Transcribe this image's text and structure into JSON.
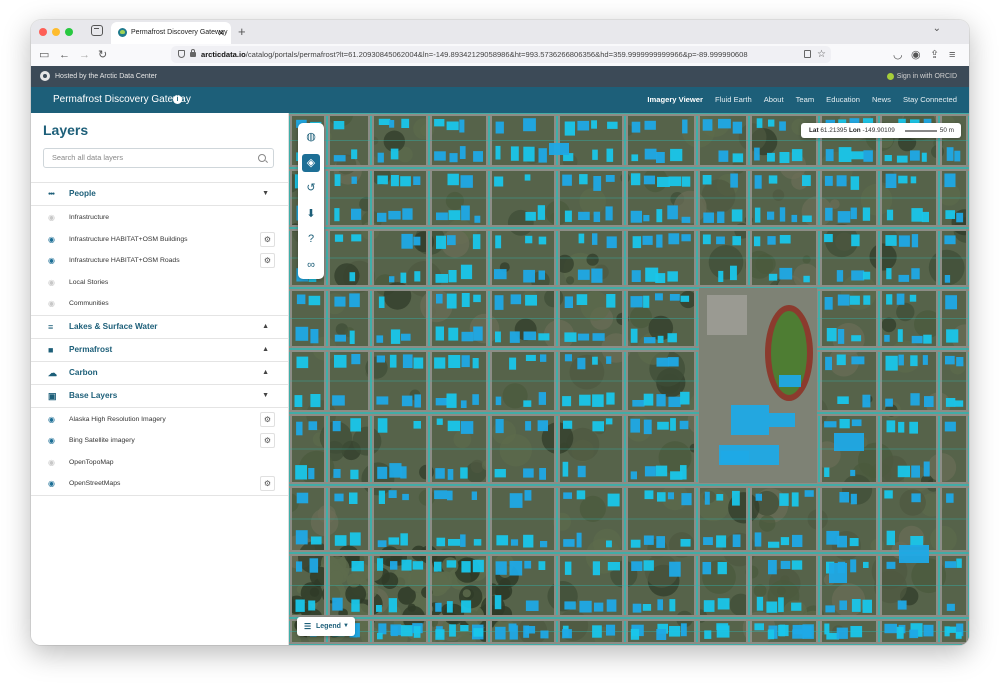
{
  "browser": {
    "tab_title": "Permafrost Discovery Gateway",
    "tab_close": "✕",
    "new_tab": "+",
    "url_host": "arcticdata.io",
    "url_rest": "/catalog/portals/permafrost?lt=61.20930845062004&ln=-149.89342129058986&ht=993.5736266806356&hd=359.9999999999966&p=-89.999990608"
  },
  "site": {
    "hosted_by": "Hosted by the Arctic Data Center",
    "sign_in": "Sign in with ORCID",
    "brand": "Permafrost Discovery Gateway",
    "nav": [
      "Imagery Viewer",
      "Fluid Earth",
      "About",
      "Team",
      "Education",
      "News",
      "Stay Connected"
    ]
  },
  "panel": {
    "title": "Layers",
    "search_placeholder": "Search all data layers",
    "groups": [
      {
        "label": "People",
        "icon": "people-icon",
        "expanded": true,
        "items": [
          {
            "label": "Infrastructure",
            "visible": false,
            "settings": false
          },
          {
            "label": "Infrastructure HABITAT+OSM Buildings",
            "visible": true,
            "settings": true
          },
          {
            "label": "Infrastructure HABITAT+OSM Roads",
            "visible": true,
            "settings": true
          },
          {
            "label": "Local Stories",
            "visible": false,
            "settings": false
          },
          {
            "label": "Communities",
            "visible": false,
            "settings": false
          }
        ]
      },
      {
        "label": "Lakes & Surface Water",
        "icon": "water-lines-icon",
        "expanded": false,
        "items": []
      },
      {
        "label": "Permafrost",
        "icon": "permafrost-icon",
        "expanded": false,
        "items": []
      },
      {
        "label": "Carbon",
        "icon": "carbon-icon",
        "expanded": false,
        "items": []
      },
      {
        "label": "Base Layers",
        "icon": "base-layers-icon",
        "expanded": true,
        "items": [
          {
            "label": "Alaska High Resolution Imagery",
            "visible": true,
            "settings": true
          },
          {
            "label": "Bing Satellite imagery",
            "visible": true,
            "settings": true
          },
          {
            "label": "OpenTopoMap",
            "visible": false,
            "settings": false
          },
          {
            "label": "OpenStreetMaps",
            "visible": true,
            "settings": true
          }
        ]
      }
    ]
  },
  "map": {
    "lat_label": "Lat",
    "lat": "61.21395",
    "lon_label": "Lon",
    "lon": "-149.90109",
    "scale": "50 m",
    "legend_label": "Legend",
    "tools": [
      "globe-icon",
      "layers-icon",
      "history-icon",
      "download-icon",
      "help-icon",
      "share-icon"
    ],
    "building_color": "#1fa9e6",
    "road_color": "#2fb6b0"
  }
}
